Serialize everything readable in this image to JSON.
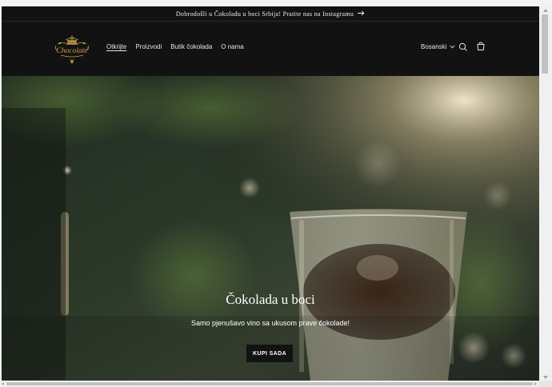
{
  "announcement": {
    "text": "Dobrodošli u Čokoladu u boci Srbija! Pratite nas na Instagramu",
    "arrow_icon": "arrow-right-icon"
  },
  "header": {
    "logo_text": "Chocolaté",
    "nav": [
      {
        "label": "Otkrijte",
        "active": true
      },
      {
        "label": "Proizvodi",
        "active": false
      },
      {
        "label": "Butik čokolada",
        "active": false
      },
      {
        "label": "O nama",
        "active": false
      }
    ],
    "language": "Bosanski",
    "icons": [
      "chevron-down-icon",
      "search-icon",
      "cart-icon"
    ]
  },
  "hero": {
    "title": "Čokolada u boci",
    "subtitle": "Samo pjenušavo vino sa ukusom prave čokolade!",
    "button_label": "KUPI SADA"
  },
  "colors": {
    "header_bg": "#121212",
    "text_light": "#ffffff",
    "logo_gold": "#c9a24a"
  }
}
